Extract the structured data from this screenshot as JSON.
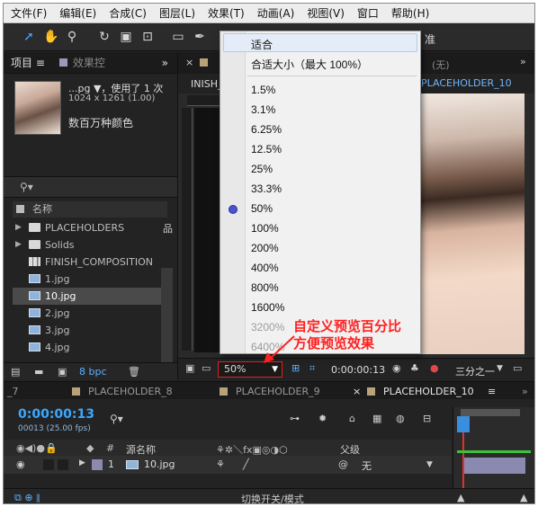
{
  "menubar": {
    "items": [
      "文件(F)",
      "编辑(E)",
      "合成(C)",
      "图层(L)",
      "效果(T)",
      "动画(A)",
      "视图(V)",
      "窗口",
      "帮助(H)"
    ]
  },
  "toolbar": {
    "right_text": "准"
  },
  "project_panel": {
    "tab_label": "项目",
    "tab_menu": "≡",
    "effects_tab": "效果控",
    "more": "»",
    "file_name": "...pg ▼，使用了 1 次",
    "file_dims": "1024 x 1261 (1.00)",
    "file_color": "数百万种颜色",
    "column_name": "名称",
    "items": [
      {
        "label": "PLACEHOLDERS",
        "type": "folder",
        "expandable": true
      },
      {
        "label": "Solids",
        "type": "folder",
        "expandable": true
      },
      {
        "label": "FINISH_COMPOSITION",
        "type": "comp",
        "expandable": false
      },
      {
        "label": "1.jpg",
        "type": "image",
        "expandable": false
      },
      {
        "label": "10.jpg",
        "type": "image",
        "expandable": false,
        "selected": true
      },
      {
        "label": "2.jpg",
        "type": "image",
        "expandable": false
      },
      {
        "label": "3.jpg",
        "type": "image",
        "expandable": false
      },
      {
        "label": "4.jpg",
        "type": "image",
        "expandable": false
      }
    ],
    "bpc": "8 bpc"
  },
  "viewer": {
    "tab_partial": "INISH_",
    "none_tab": "(无)",
    "comp_tab": "PLACEHOLDER_10",
    "zoom_value": "50%",
    "timecode": "0:00:00:13",
    "resolution": "三分之一"
  },
  "zoom_menu": {
    "items": [
      {
        "label": "适合",
        "highlighted": true
      },
      {
        "label": "合适大小（最大 100%）"
      },
      {
        "label": "1.5%"
      },
      {
        "label": "3.1%"
      },
      {
        "label": "6.25%"
      },
      {
        "label": "12.5%"
      },
      {
        "label": "25%"
      },
      {
        "label": "33.3%"
      },
      {
        "label": "50%",
        "checked": true
      },
      {
        "label": "100%"
      },
      {
        "label": "200%"
      },
      {
        "label": "400%"
      },
      {
        "label": "800%"
      },
      {
        "label": "1600%"
      },
      {
        "label": "3200%",
        "disabled": true
      },
      {
        "label": "6400%",
        "disabled": true
      }
    ]
  },
  "annotation": {
    "line1": "自定义预览百分比",
    "line2": "方便预览效果",
    "color": "#ff2020"
  },
  "timeline": {
    "tabs": [
      "_7",
      "PLACEHOLDER_8",
      "PLACEHOLDER_9",
      "PLACEHOLDER_10"
    ],
    "active_tab": "PLACEHOLDER_10",
    "timecode": "0:00:00:13",
    "fps": "00013 (25.00 fps)",
    "col_source": "源名称",
    "col_number": "#",
    "col_parent": "父级",
    "layer_number": "1",
    "layer_name": "10.jpg",
    "parent_value": "无",
    "footer": "切换开关/模式"
  },
  "colors": {
    "accent_blue": "#3aa8ff",
    "highlight_red": "#e02020"
  }
}
